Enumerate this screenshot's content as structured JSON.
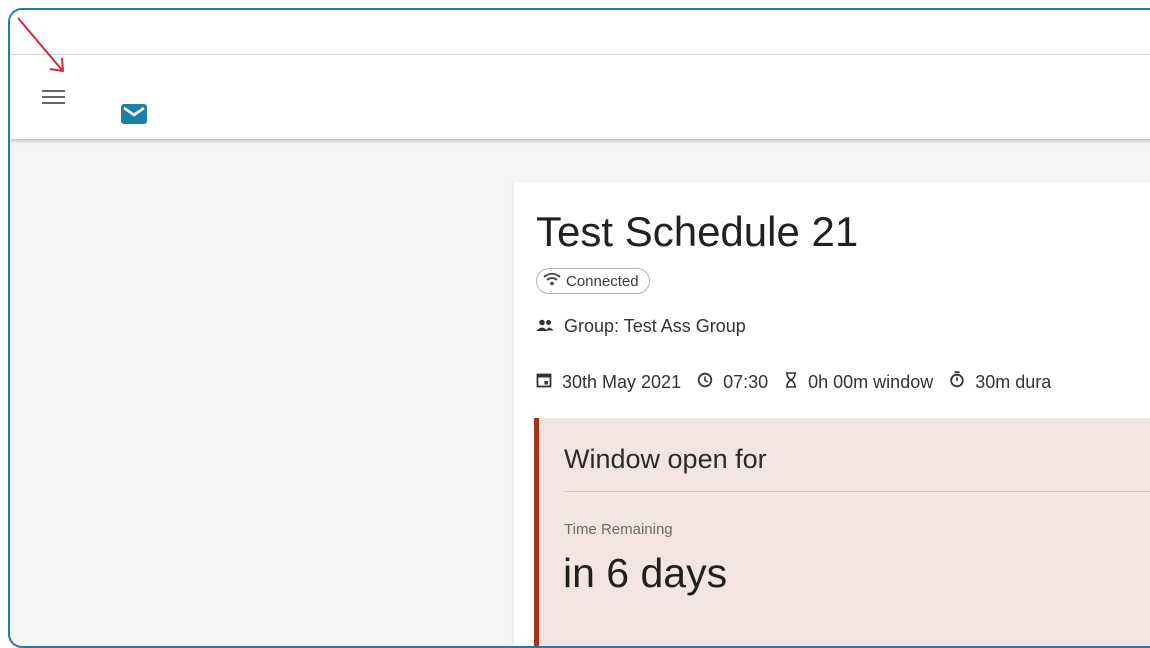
{
  "app": {
    "accent_color": "#1b7fa6",
    "menu_icon": "hamburger-menu-icon",
    "mail_icon": "mail-icon",
    "annotation_color": "#d6263a"
  },
  "schedule": {
    "title": "Test Schedule 21",
    "connection_status": "Connected",
    "group": "Group: Test Ass Group",
    "date": "30th May 2021",
    "time": "07:30",
    "window": "0h 00m window",
    "duration": "30m dura"
  },
  "window_panel": {
    "heading": "Window open for",
    "label": "Time Remaining",
    "value": "in 6 days",
    "accent_color": "#a8321a",
    "background": "#f5e5e2"
  }
}
